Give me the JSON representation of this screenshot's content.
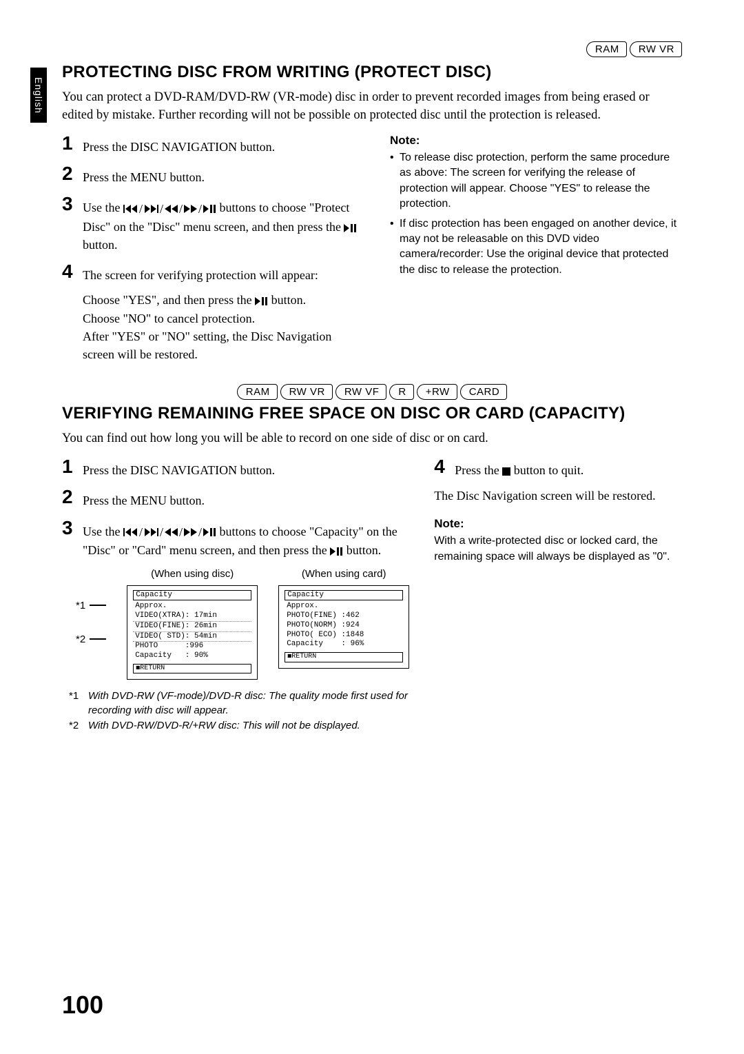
{
  "side_tab": "English",
  "section1": {
    "badges": [
      "RAM",
      "RW VR"
    ],
    "title": "PROTECTING DISC FROM WRITING (PROTECT DISC)",
    "intro": "You can protect a DVD-RAM/DVD-RW (VR-mode) disc in order to prevent recorded images from being erased or edited by mistake. Further recording will not be possible on protected disc until the protection is released.",
    "steps": {
      "s1": {
        "num": "1",
        "text": "Press the DISC NAVIGATION button."
      },
      "s2": {
        "num": "2",
        "text": "Press the MENU button."
      },
      "s3": {
        "num": "3",
        "pre": "Use the ",
        "mid": " buttons to choose \"Protect Disc\" on the \"Disc\" menu screen, and then press the ",
        "post": " button."
      },
      "s4": {
        "num": "4",
        "text": "The screen for verifying protection will appear:",
        "sub": "Choose \"YES\", and then press the ",
        "sub_post": " button.\nChoose \"NO\" to cancel protection.\nAfter \"YES\" or \"NO\" setting, the Disc Navigation screen will be restored."
      }
    },
    "note_label": "Note:",
    "notes": [
      "To release disc protection, perform the same procedure as above: The screen for verifying the release of protection will appear. Choose \"YES\" to release the protection.",
      "If disc protection has been engaged on another device, it may not be releasable on this DVD video camera/recorder: Use the original device that protected the disc to release the protection."
    ]
  },
  "section2": {
    "badges": [
      "RAM",
      "RW VR",
      "RW VF",
      "R",
      "+RW",
      "CARD"
    ],
    "title": "VERIFYING REMAINING FREE SPACE ON DISC OR CARD (CAPACITY)",
    "intro": "You can find out how long you will be able to record on one side of disc or on card.",
    "steps_left": {
      "s1": {
        "num": "1",
        "text": "Press the DISC NAVIGATION button."
      },
      "s2": {
        "num": "2",
        "text": "Press the MENU button."
      },
      "s3": {
        "num": "3",
        "pre": "Use the ",
        "mid": " buttons to choose \"Capacity\" on the \"Disc\" or \"Card\" menu screen, and then press the ",
        "post": " button."
      }
    },
    "steps_right": {
      "s4": {
        "num": "4",
        "pre": "Press the ",
        "post": " button to quit."
      },
      "after": "The Disc Navigation screen will be restored."
    },
    "shot_labels": {
      "disc": "(When using disc)",
      "card": "(When using card)"
    },
    "shot_disc": {
      "title": "Capacity",
      "approx": "Approx.",
      "l1": "VIDEO(XTRA): 17min",
      "l2": "VIDEO(FINE): 26min",
      "l3": "VIDEO( STD): 54min",
      "l4": "PHOTO      :996",
      "l5": "Capacity   : 90%",
      "return": "◼RETURN"
    },
    "shot_card": {
      "title": "Capacity",
      "approx": "Approx.",
      "l1": "PHOTO(FINE) :462",
      "l2": "PHOTO(NORM) :924",
      "l3": "PHOTO( ECO) :1848",
      "l4": "Capacity    : 96%",
      "return": "◼RETURN"
    },
    "callouts": {
      "c1": "*1",
      "c2": "*2"
    },
    "footnotes": {
      "f1_tag": "*1",
      "f1": "With DVD-RW (VF-mode)/DVD-R disc: The quality mode first used for recording with disc will appear.",
      "f2_tag": "*2",
      "f2": "With DVD-RW/DVD-R/+RW disc: This will not be displayed."
    },
    "note_label": "Note:",
    "note_text": "With a write-protected disc or locked card, the remaining space will always be displayed as \"0\"."
  },
  "page_number": "100"
}
